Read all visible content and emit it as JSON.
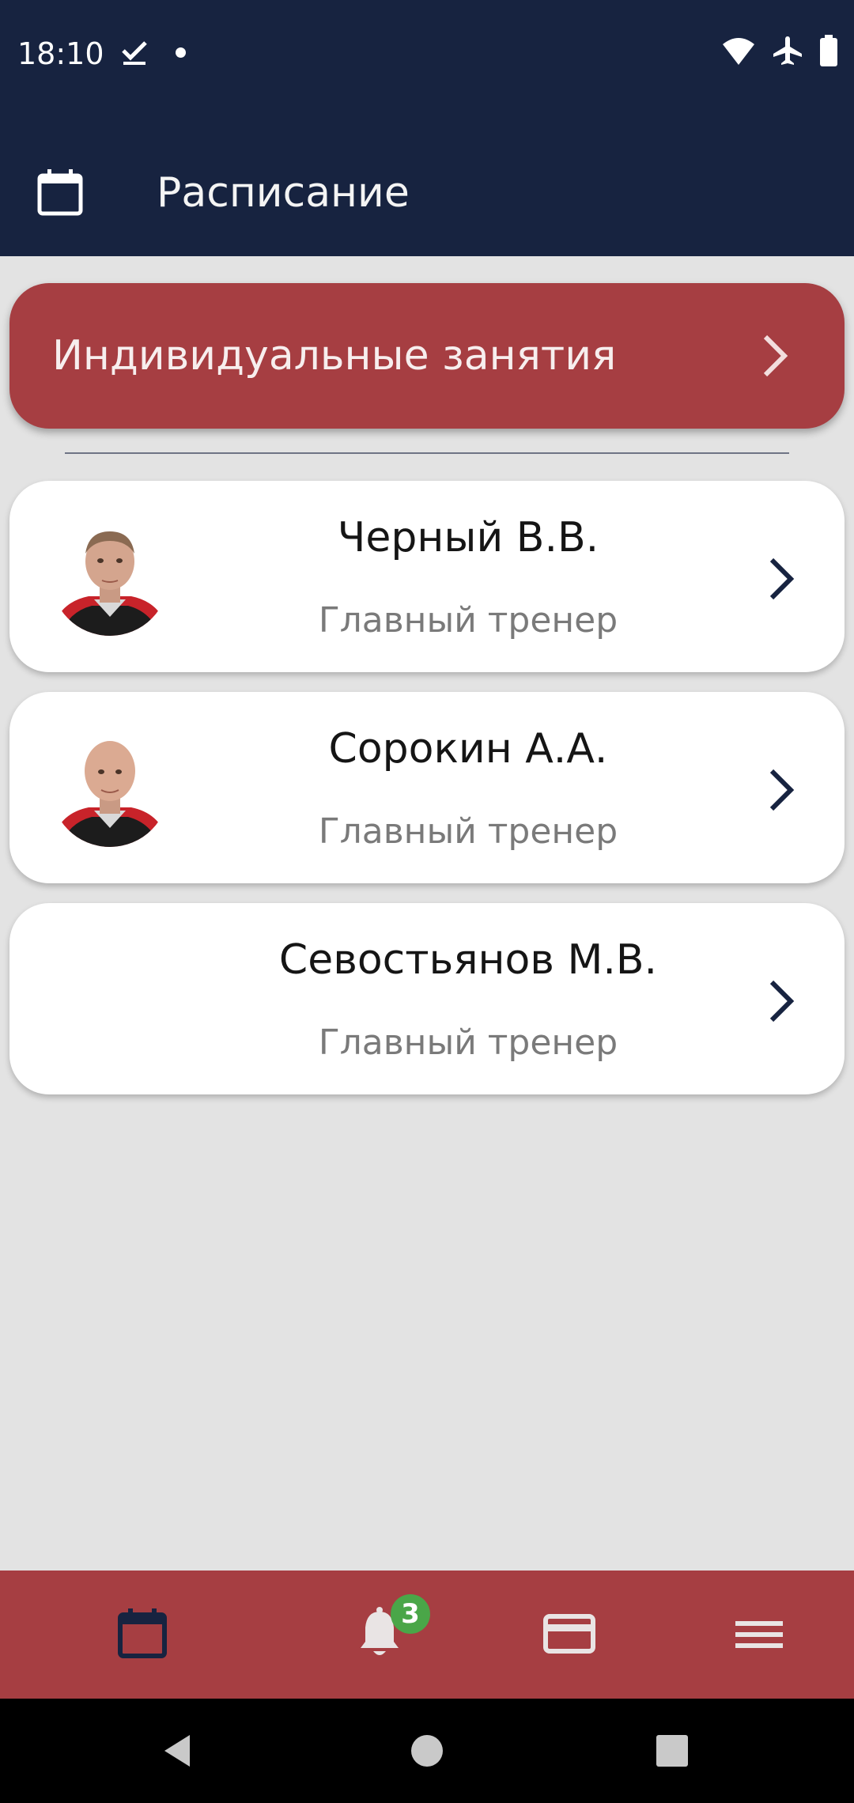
{
  "status_bar": {
    "time": "18:10",
    "icons": [
      "download-done-icon",
      "notification-dot",
      "wifi-icon",
      "airplane-icon",
      "battery-icon"
    ]
  },
  "app_bar": {
    "icon": "calendar-icon",
    "title": "Расписание"
  },
  "banner": {
    "label": "Индивидуальные занятия",
    "icon": "chevron-right-icon"
  },
  "trainers": [
    {
      "name": "Черный В.В.",
      "role": "Главный тренер",
      "has_photo": true
    },
    {
      "name": "Сорокин А.А.",
      "role": "Главный тренер",
      "has_photo": true
    },
    {
      "name": "Севостьянов М.В.",
      "role": "Главный тренер",
      "has_photo": false
    }
  ],
  "bottom_nav": {
    "items": [
      {
        "icon": "calendar-icon",
        "active": true
      },
      {
        "icon": "bell-icon",
        "badge": "3"
      },
      {
        "icon": "credit-card-icon"
      },
      {
        "icon": "menu-icon"
      }
    ]
  },
  "system_nav": [
    "back-icon",
    "home-icon",
    "recents-icon"
  ],
  "colors": {
    "primary_dark": "#172340",
    "accent_red": "#a63e42",
    "background": "#e3e3e3",
    "badge_green": "#4aa648"
  }
}
